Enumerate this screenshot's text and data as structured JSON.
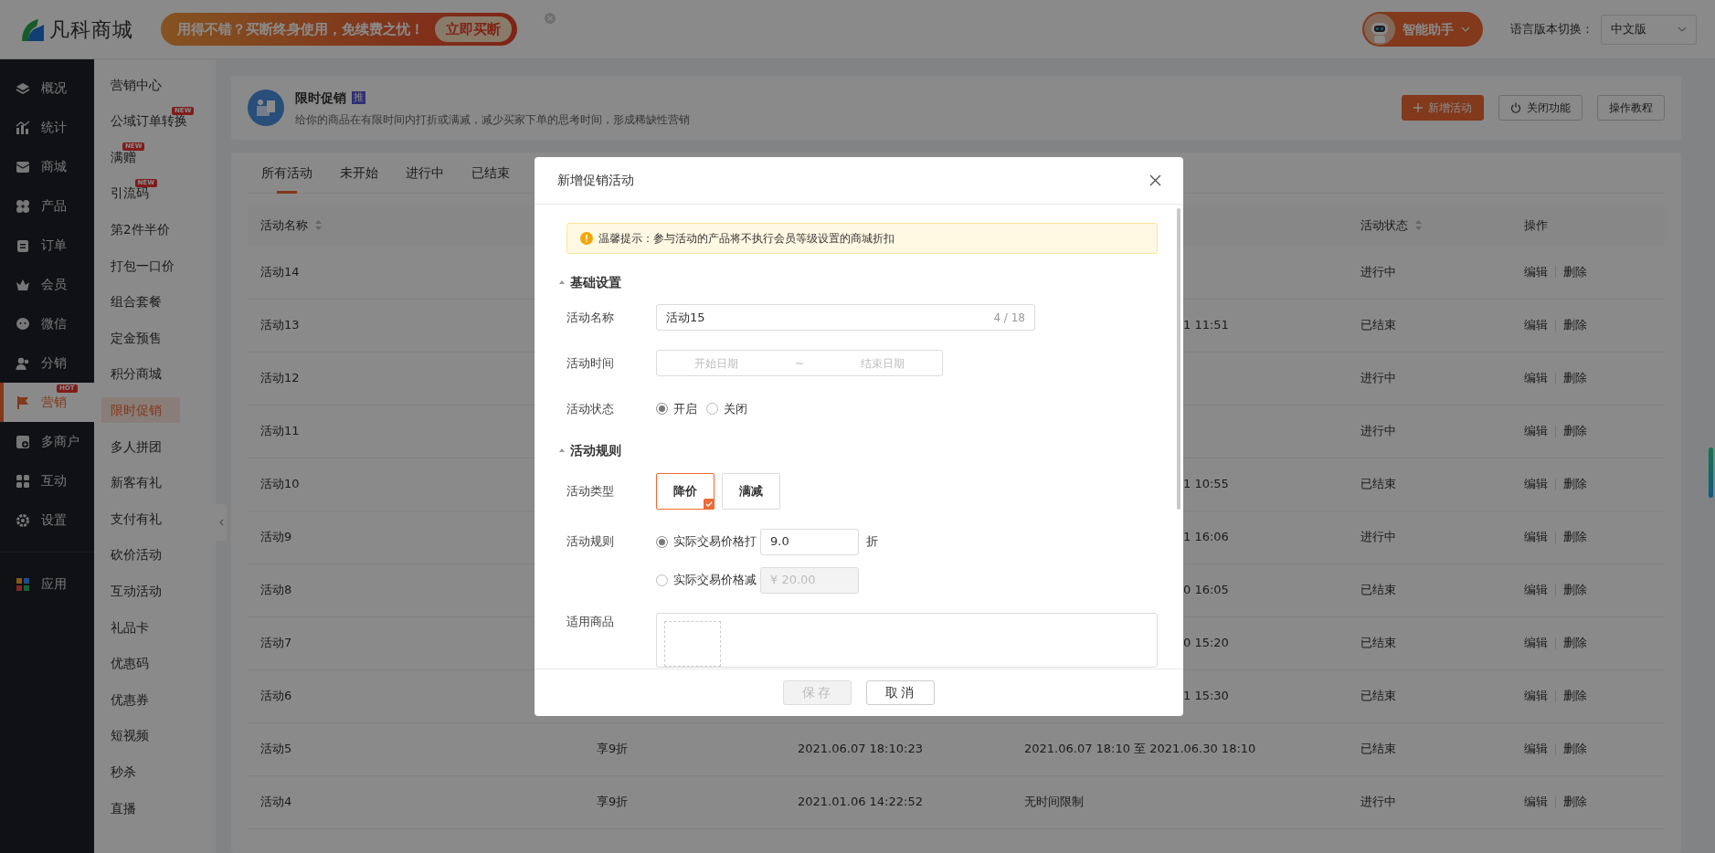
{
  "top_bar": {
    "logo_text": "凡科商城",
    "promo": {
      "text": "用得不错？买断终身使用，免续费之忧！",
      "button": "立即买断"
    },
    "assistant": "智能助手",
    "language": {
      "label": "语言版本切换：",
      "value": "中文版"
    }
  },
  "sidebar": {
    "items": [
      {
        "label": "概况",
        "selected": false
      },
      {
        "label": "统计",
        "selected": false
      },
      {
        "label": "商城",
        "selected": false
      },
      {
        "label": "产品",
        "selected": false
      },
      {
        "label": "订单",
        "selected": false
      },
      {
        "label": "会员",
        "selected": false
      },
      {
        "label": "微信",
        "selected": false
      },
      {
        "label": "分销",
        "selected": false
      },
      {
        "label": "营销",
        "selected": true,
        "badge": "HOT"
      },
      {
        "label": "多商户",
        "selected": false
      },
      {
        "label": "互动",
        "selected": false
      },
      {
        "label": "设置",
        "selected": false
      },
      {
        "label": "应用",
        "selected": false
      }
    ]
  },
  "submenu": {
    "items": [
      {
        "label": "营销中心",
        "selected": false
      },
      {
        "label": "公域订单转换",
        "selected": false,
        "badge": "NEW"
      },
      {
        "label": "满赠",
        "selected": false,
        "badge": "NEW"
      },
      {
        "label": "引流码",
        "selected": false,
        "badge": "NEW"
      },
      {
        "label": "第2件半价",
        "selected": false
      },
      {
        "label": "打包一口价",
        "selected": false
      },
      {
        "label": "组合套餐",
        "selected": false
      },
      {
        "label": "定金预售",
        "selected": false
      },
      {
        "label": "积分商城",
        "selected": false
      },
      {
        "label": "限时促销",
        "selected": true
      },
      {
        "label": "多人拼团",
        "selected": false
      },
      {
        "label": "新客有礼",
        "selected": false
      },
      {
        "label": "支付有礼",
        "selected": false
      },
      {
        "label": "砍价活动",
        "selected": false
      },
      {
        "label": "互动活动",
        "selected": false
      },
      {
        "label": "礼品卡",
        "selected": false
      },
      {
        "label": "优惠码",
        "selected": false
      },
      {
        "label": "优惠券",
        "selected": false
      },
      {
        "label": "短视频",
        "selected": false
      },
      {
        "label": "秒杀",
        "selected": false
      },
      {
        "label": "直播",
        "selected": false
      }
    ]
  },
  "page_header": {
    "title": "限时促销",
    "tag": "推",
    "description": "给你的商品在有限时间内打折或满减，减少买家下单的思考时间，形成稀缺性营销",
    "buttons": [
      {
        "label": "新增活动",
        "kind": "primary"
      },
      {
        "label": "关闭功能",
        "kind": "power"
      },
      {
        "label": "操作教程",
        "kind": "plain"
      }
    ]
  },
  "tabs": [
    {
      "label": "所有活动",
      "selected": true
    },
    {
      "label": "未开始",
      "selected": false
    },
    {
      "label": "进行中",
      "selected": false
    },
    {
      "label": "已结束",
      "selected": false
    }
  ],
  "table": {
    "columns": [
      {
        "label": "活动名称",
        "sortable": true
      },
      {},
      {},
      {},
      {
        "label": "活动状态",
        "sortable": true
      },
      {
        "label": "操作"
      }
    ],
    "rows": [
      {
        "name": "活动14",
        "status": "进行中",
        "actions": [
          "编辑",
          "删除"
        ]
      },
      {
        "name": "活动13",
        "column_4": "1 11:51",
        "status": "已结束",
        "actions": [
          "编辑",
          "删除"
        ]
      },
      {
        "name": "活动12",
        "status": "进行中",
        "actions": [
          "编辑",
          "删除"
        ]
      },
      {
        "name": "活动11",
        "status": "进行中",
        "actions": [
          "编辑",
          "删除"
        ]
      },
      {
        "name": "活动10",
        "column_4": "1 10:55",
        "status": "已结束",
        "actions": [
          "编辑",
          "删除"
        ]
      },
      {
        "name": "活动9",
        "column_4": "1 16:06",
        "status": "进行中",
        "actions": [
          "编辑",
          "删除"
        ]
      },
      {
        "name": "活动8",
        "column_4": "0 16:05",
        "status": "已结束",
        "actions": [
          "编辑",
          "删除"
        ]
      },
      {
        "name": "活动7",
        "column_4": "0 15:20",
        "status": "已结束",
        "actions": [
          "编辑",
          "删除"
        ]
      },
      {
        "name": "活动6",
        "column_4": "1 15:30",
        "status": "已结束",
        "actions": [
          "编辑",
          "删除"
        ]
      },
      {
        "name": "活动5",
        "column_2": "享9折",
        "column_3": "2021.06.07 18:10:23",
        "column_4": "2021.06.07 18:10 至 2021.06.30 18:10",
        "status": "已结束",
        "actions": [
          "编辑",
          "删除"
        ]
      },
      {
        "name": "活动4",
        "column_2": "享9折",
        "column_3": "2021.01.06 14:22:52",
        "column_4": "无时间限制",
        "status": "进行中",
        "actions": [
          "编辑",
          "删除"
        ]
      }
    ]
  },
  "modal": {
    "title": "新增促销活动",
    "notice": "温馨提示：参与活动的产品将不执行会员等级设置的商城折扣",
    "basic": {
      "heading": "基础设置",
      "name": {
        "label": "活动名称",
        "value": "活动15",
        "counter": "4 / 18"
      },
      "time": {
        "label": "活动时间",
        "start_placeholder": "开始日期",
        "separator": "~",
        "end_placeholder": "结束日期"
      },
      "state": {
        "label": "活动状态",
        "options": [
          {
            "label": "开启",
            "selected": true
          },
          {
            "label": "关闭",
            "selected": false
          }
        ]
      }
    },
    "rules": {
      "heading": "活动规则",
      "type": {
        "label": "活动类型",
        "options": [
          {
            "label": "降价",
            "selected": true
          },
          {
            "label": "满减",
            "selected": false
          }
        ]
      },
      "rule": {
        "label": "活动规则",
        "options": [
          {
            "label": "实际交易价格打",
            "value": "9.0",
            "suffix": "折",
            "selected": true,
            "disabled": false
          },
          {
            "label": "实际交易价格减",
            "placeholder": "¥ 20.00",
            "selected": false,
            "disabled": true
          }
        ]
      },
      "products": {
        "label": "适用商品"
      }
    },
    "footer": [
      {
        "label": "保存",
        "disabled": true
      },
      {
        "label": "取消",
        "disabled": false
      }
    ]
  }
}
